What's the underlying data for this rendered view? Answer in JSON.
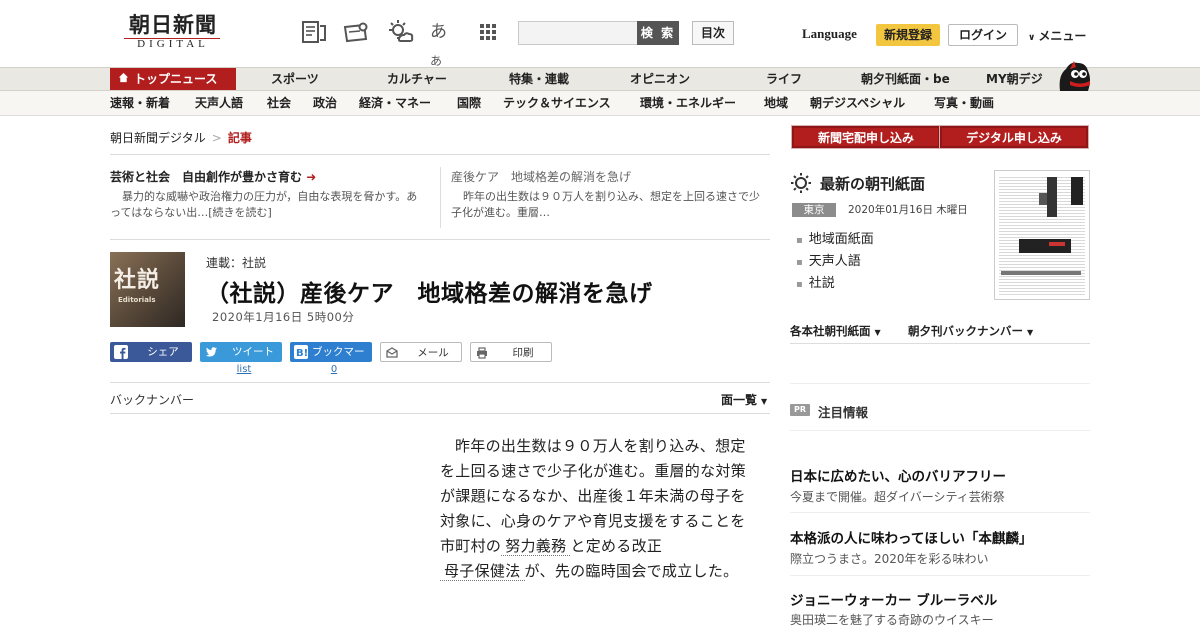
{
  "header": {
    "logo_ja": "朝日新聞",
    "logo_en": "DIGITAL",
    "search_placeholder": "",
    "search_label": "検 索",
    "toc_label": "目次",
    "language_label": "Language",
    "signup_label": "新規登録",
    "login_label": "ログイン",
    "menu_label": "メニュー",
    "font_icon_label": "あ"
  },
  "nav_primary": [
    {
      "label": "トップニュース",
      "active": true
    },
    {
      "label": "スポーツ"
    },
    {
      "label": "カルチャー"
    },
    {
      "label": "特集・連載"
    },
    {
      "label": "オピニオン"
    },
    {
      "label": "ライフ"
    },
    {
      "label": "朝夕刊紙面・be"
    },
    {
      "label": "MY朝デジ"
    }
  ],
  "nav_secondary": [
    {
      "label": "速報・新着"
    },
    {
      "label": "天声人語"
    },
    {
      "label": "社会"
    },
    {
      "label": "政治"
    },
    {
      "label": "経済・マネー"
    },
    {
      "label": "国際"
    },
    {
      "label": "テック＆サイエンス"
    },
    {
      "label": "環境・エネルギー"
    },
    {
      "label": "地域"
    },
    {
      "label": "朝デジスペシャル"
    },
    {
      "label": "写真・動画"
    }
  ],
  "breadcrumb": {
    "root": "朝日新聞デジタル",
    "separator": ">",
    "current": "記事"
  },
  "related": [
    {
      "title": "芸術と社会　自由創作が豊かさ育む",
      "arrow": "➜",
      "desc": "暴力的な威嚇や政治権力の圧力が，自由な表現を脅かす。あってはならない出…",
      "more": "[続きを読む]"
    },
    {
      "title": "産後ケア　地域格差の解消を急げ",
      "desc": "昨年の出生数は９０万人を割り込み、想定を上回る速さで少子化が進む。重層…"
    }
  ],
  "article": {
    "thumb_kanji": "社説",
    "thumb_en": "Editorials",
    "series": "連載：社説",
    "headline": "（社説）産後ケア　地域格差の解消を急げ",
    "date": "2020年1月16日 5時00分",
    "body_pre": "昨年の出生数は９０万人を割り込み、想定を上回る速さで少子化が進む。重層的な対策が課題になるなか、出産後１年未満の母子を対象に、心身のケアや育児支援をすることを市町村の",
    "kw1": "努力義務",
    "body_mid": "と定める改正",
    "kw2": "母子保健法",
    "body_post": "が、先の臨時国会で成立した。"
  },
  "share": {
    "facebook": "シェア",
    "twitter": "ツイート",
    "twitter_count": "list",
    "hatena": "ブックマーク",
    "hatena_count": "0",
    "mail": "メール",
    "print": "印刷"
  },
  "backnumber_label": "バックナンバー",
  "page_index_label": "面一覧",
  "sidebar": {
    "cta_home": "新聞宅配申し込み",
    "cta_digital": "デジタル申し込み",
    "paper_title": "最新の朝刊紙面",
    "region": "東京",
    "paper_date": "2020年01月16日 木曜日",
    "paper_links": [
      "地域面紙面",
      "天声人語",
      "社説"
    ],
    "link_regional": "各本社朝刊紙面",
    "link_backnumber": "朝夕刊バックナンバー",
    "pr_badge": "PR",
    "pr_title": "注目情報",
    "promos": [
      {
        "title": "日本に広めたい、心のバリアフリー",
        "desc": "今夏まで開催。超ダイバーシティ芸術祭"
      },
      {
        "title": "本格派の人に味わってほしい「本麒麟」",
        "desc": "際立つうまさ。2020年を彩る味わい"
      },
      {
        "title": "ジョニーウォーカー ブルーラベル",
        "desc": "奥田瑛二を魅了する奇跡のウイスキー"
      }
    ]
  },
  "colors": {
    "brand_red": "#b21e1e",
    "signup_yellow": "#f3c63f",
    "facebook": "#3b5998",
    "twitter": "#3a9ad9",
    "hatena": "#2f7fd1"
  }
}
